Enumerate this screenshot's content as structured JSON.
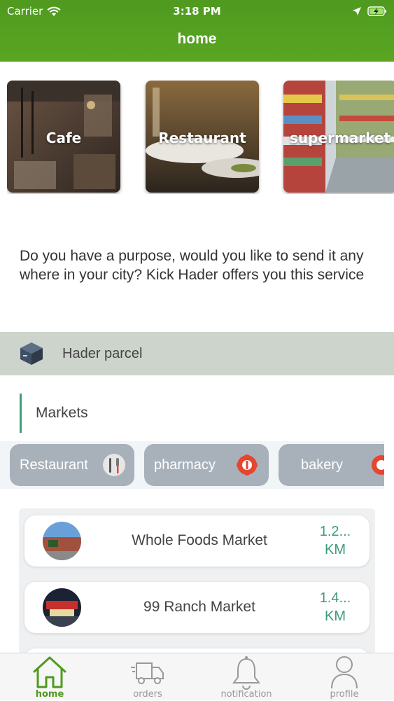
{
  "status_bar": {
    "carrier": "Carrier",
    "time": "3:18 PM"
  },
  "header": {
    "title": "home"
  },
  "categories": [
    {
      "label": "Cafe"
    },
    {
      "label": "Restaurant"
    },
    {
      "label": "supermarket"
    }
  ],
  "purpose_text": "Do you have a purpose, would you like to send it any where in your city? Kick Hader offers you this service",
  "parcel": {
    "label": "Hader parcel"
  },
  "markets": {
    "heading": "Markets"
  },
  "chips": [
    {
      "label": "Restaurant"
    },
    {
      "label": "pharmacy"
    },
    {
      "label": "bakery"
    }
  ],
  "stores": [
    {
      "name": "Whole Foods Market",
      "distance_value": "1.2...",
      "distance_unit": "KM"
    },
    {
      "name": "99 Ranch Market",
      "distance_value": "1.4...",
      "distance_unit": "KM"
    }
  ],
  "tabs": [
    {
      "label": "home"
    },
    {
      "label": "orders"
    },
    {
      "label": "notification"
    },
    {
      "label": "profile"
    }
  ],
  "colors": {
    "header_green": "#4f9a1f",
    "accent": "#3d9b7d",
    "chip": "#a8b0ba"
  }
}
